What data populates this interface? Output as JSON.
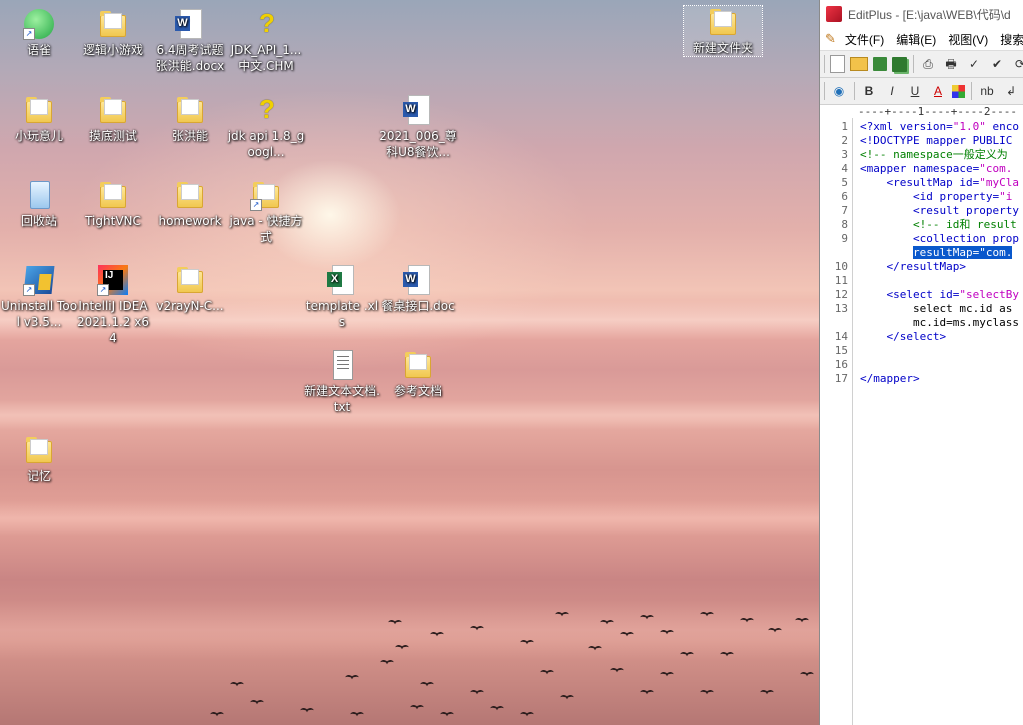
{
  "desktop": {
    "icons": [
      {
        "label": "语雀",
        "icon": "yuque-app-icon"
      },
      {
        "label": "逻辑小游戏",
        "icon": "folder-icon"
      },
      {
        "label": "6.4周考试题张洪能.docx",
        "icon": "word-doc-icon"
      },
      {
        "label": "JDK_API_1...中文.CHM",
        "icon": "chm-help-icon"
      },
      {
        "label": "新建文件夹",
        "icon": "folder-icon"
      },
      {
        "label": "小玩意儿",
        "icon": "folder-icon"
      },
      {
        "label": "摸底测试",
        "icon": "folder-icon"
      },
      {
        "label": "张洪能",
        "icon": "folder-icon"
      },
      {
        "label": "jdk api 1.8_googl...",
        "icon": "chm-help-icon"
      },
      {
        "label": "2021_006_尊科U8餐饮...",
        "icon": "word-doc-icon"
      },
      {
        "label": "回收站",
        "icon": "recycle-bin-icon"
      },
      {
        "label": "TightVNC",
        "icon": "folder-icon"
      },
      {
        "label": "homework",
        "icon": "folder-icon"
      },
      {
        "label": "java - 快捷方式",
        "icon": "folder-shortcut-icon"
      },
      {
        "label": "Uninstall Tool v3.5...",
        "icon": "uninstall-tool-icon"
      },
      {
        "label": "IntelliJ IDEA 2021.1.2 x64",
        "icon": "intellij-idea-icon"
      },
      {
        "label": "v2rayN-C...",
        "icon": "folder-icon"
      },
      {
        "label": "template .xls",
        "icon": "excel-file-icon"
      },
      {
        "label": "餐桌接口.doc",
        "icon": "word-doc-icon"
      },
      {
        "label": "新建文本文档.txt",
        "icon": "text-file-icon"
      },
      {
        "label": "参考文档",
        "icon": "folder-icon"
      },
      {
        "label": "记忆",
        "icon": "folder-icon"
      }
    ]
  },
  "editplus": {
    "title": "EditPlus - [E:\\java\\WEB\\代码\\d",
    "menu": [
      "文件(F)",
      "编辑(E)",
      "视图(V)",
      "搜索"
    ],
    "format_toolbar": {
      "bold": "B",
      "italic": "I",
      "underline": "U",
      "color": "A",
      "nb": "nb",
      "wrap": "↲"
    },
    "ruler": "----+----1----+----2----",
    "lines": [
      {
        "n": "1",
        "segments": [
          {
            "t": "<?xml ",
            "c": "tag"
          },
          {
            "t": "version=",
            "c": "tag"
          },
          {
            "t": "\"1.0\"",
            "c": "str"
          },
          {
            "t": " enco",
            "c": "tag"
          }
        ]
      },
      {
        "n": "2",
        "segments": [
          {
            "t": "<!DOCTYPE mapper PUBLIC",
            "c": "tag"
          }
        ]
      },
      {
        "n": "3",
        "segments": [
          {
            "t": "<!-- namespace一般定义为",
            "c": "cmt"
          }
        ]
      },
      {
        "n": "4",
        "segments": [
          {
            "t": "<mapper ",
            "c": "tag"
          },
          {
            "t": "namespace=",
            "c": "tag"
          },
          {
            "t": "\"com.",
            "c": "str"
          }
        ]
      },
      {
        "n": "5",
        "segments": [
          {
            "t": "    <resultMap ",
            "c": "tag"
          },
          {
            "t": "id=",
            "c": "tag"
          },
          {
            "t": "\"myCla",
            "c": "str"
          }
        ]
      },
      {
        "n": "6",
        "segments": [
          {
            "t": "        <id ",
            "c": "tag"
          },
          {
            "t": "property=",
            "c": "tag"
          },
          {
            "t": "\"i",
            "c": "str"
          }
        ]
      },
      {
        "n": "7",
        "segments": [
          {
            "t": "        <result property",
            "c": "tag"
          }
        ]
      },
      {
        "n": "8",
        "segments": [
          {
            "t": "        <!-- id和 result",
            "c": "cmt"
          }
        ]
      },
      {
        "n": "9",
        "segments": [
          {
            "t": "        <collection prop",
            "c": "tag"
          }
        ]
      },
      {
        "n": "",
        "segments": [
          {
            "t": "        ",
            "c": "plain"
          },
          {
            "t": "resultMap=\"com.",
            "c": "sel"
          }
        ]
      },
      {
        "n": "10",
        "segments": [
          {
            "t": "    </resultMap>",
            "c": "tag"
          }
        ]
      },
      {
        "n": "11",
        "segments": []
      },
      {
        "n": "12",
        "segments": [
          {
            "t": "    <select ",
            "c": "tag"
          },
          {
            "t": "id=",
            "c": "tag"
          },
          {
            "t": "\"selectBy",
            "c": "str"
          }
        ]
      },
      {
        "n": "13",
        "segments": [
          {
            "t": "        select mc.id as",
            "c": "plain"
          }
        ]
      },
      {
        "n": "",
        "segments": [
          {
            "t": "        mc.id=ms.myclass",
            "c": "plain"
          }
        ]
      },
      {
        "n": "14",
        "segments": [
          {
            "t": "    </select>",
            "c": "tag"
          }
        ]
      },
      {
        "n": "15",
        "segments": []
      },
      {
        "n": "16",
        "segments": []
      },
      {
        "n": "17",
        "segments": [
          {
            "t": "</mapper>",
            "c": "tag"
          }
        ]
      }
    ]
  }
}
